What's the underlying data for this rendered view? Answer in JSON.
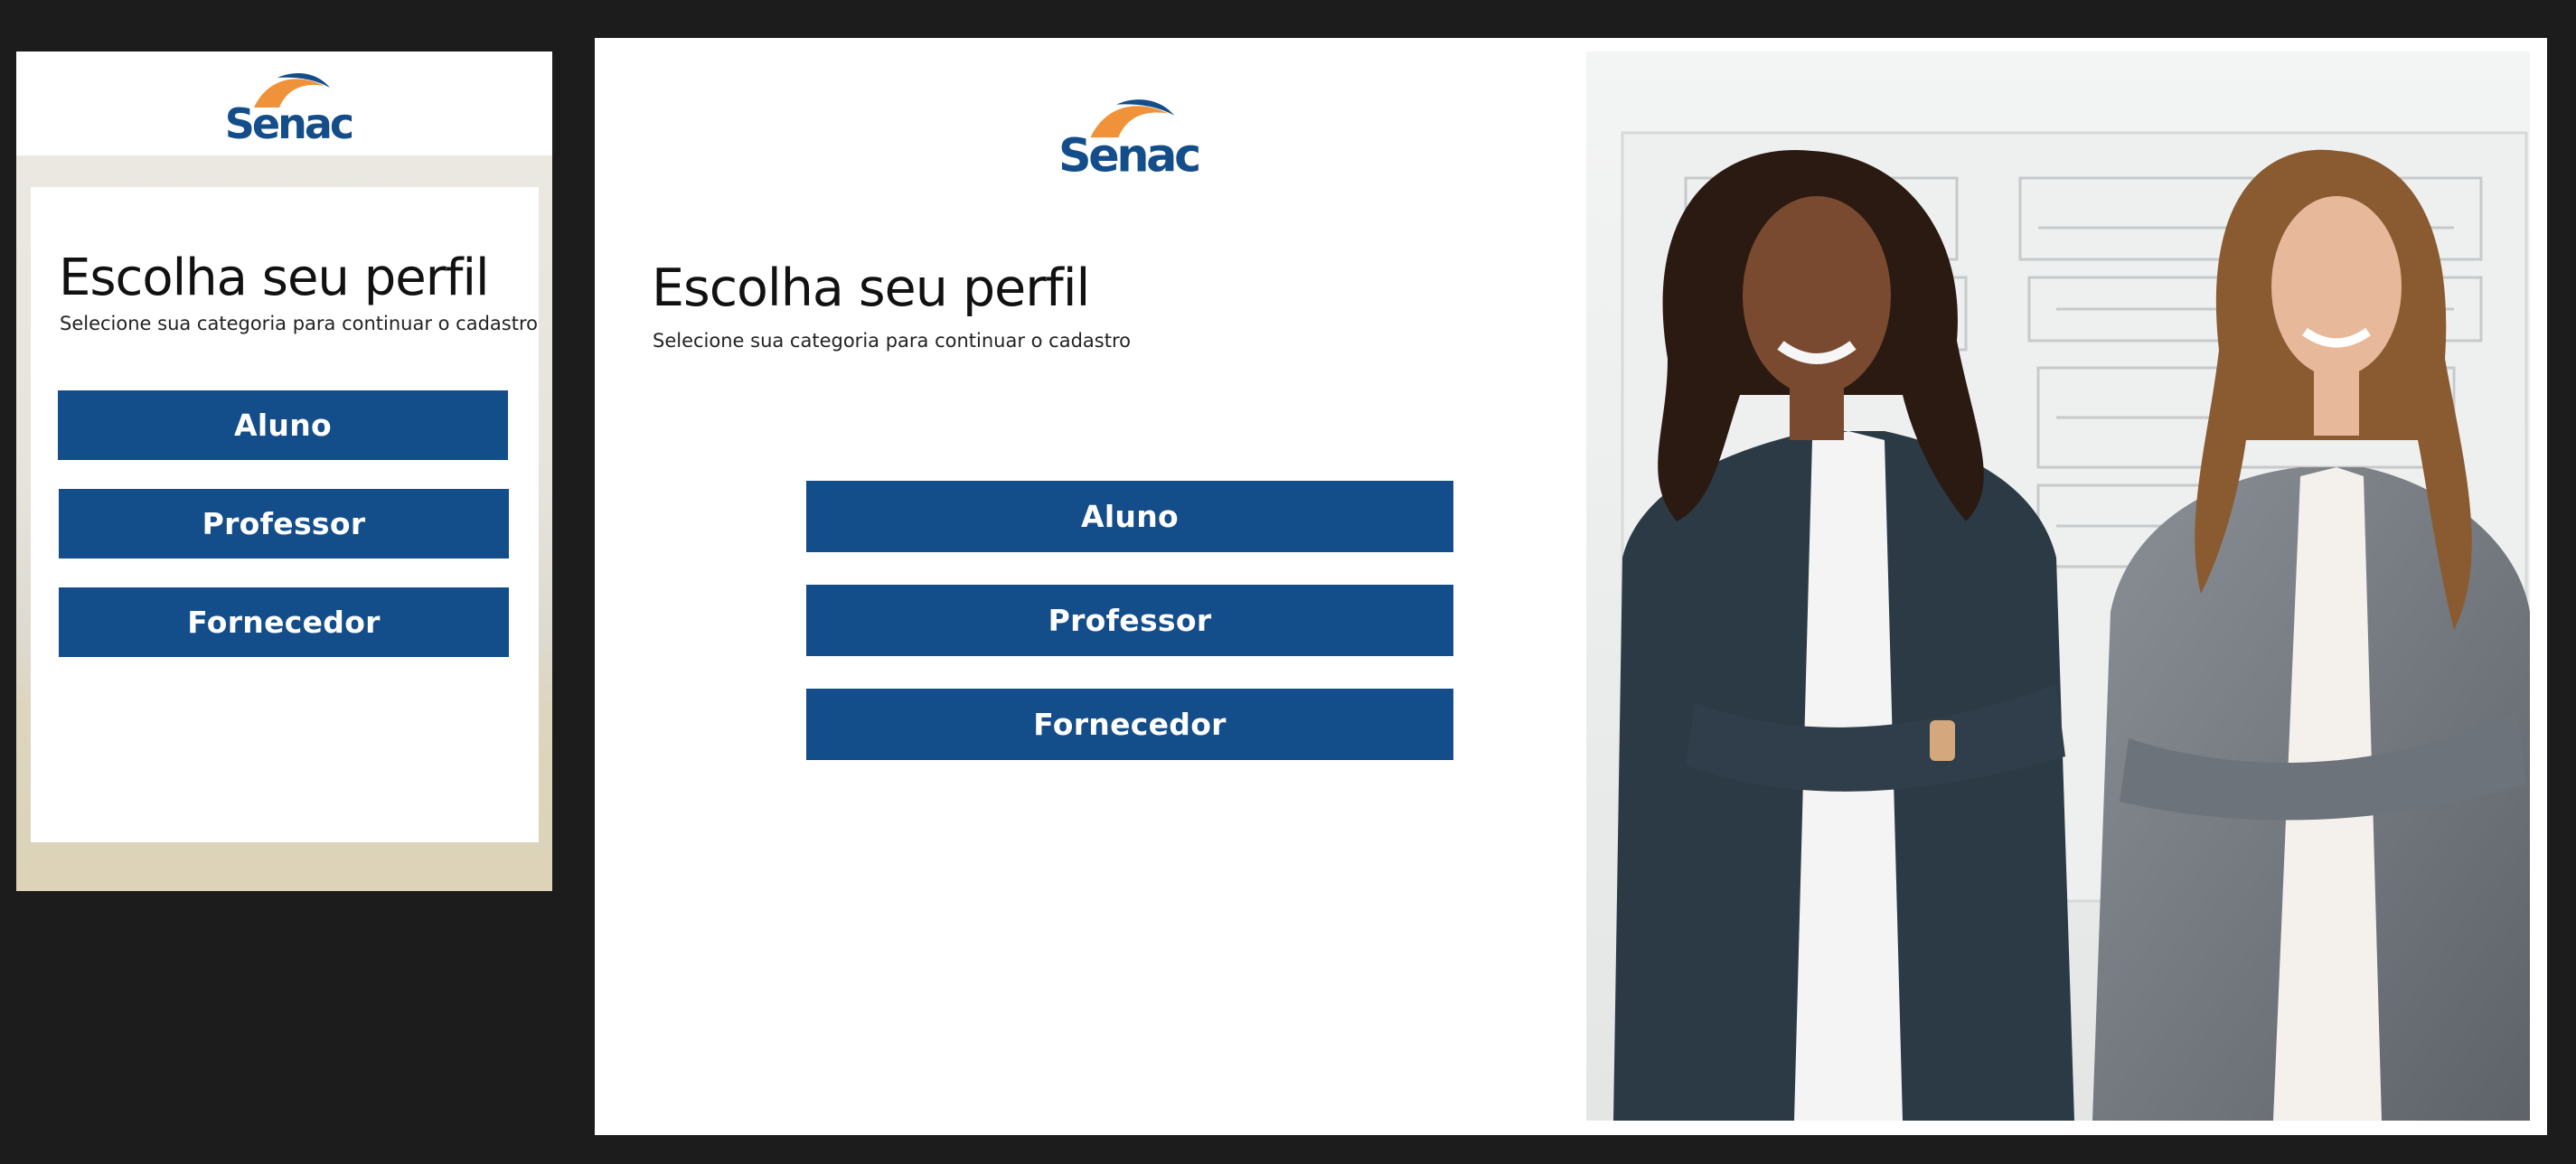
{
  "brand": {
    "name": "Senac",
    "color": "#134d8a",
    "accent_color": "#f0923a"
  },
  "profile_selection": {
    "title": "Escolha seu perfil",
    "subtitle": "Selecione sua categoria para continuar o cadastro",
    "options": [
      {
        "label": "Aluno"
      },
      {
        "label": "Professor"
      },
      {
        "label": "Fornecedor"
      }
    ]
  },
  "hero_image": {
    "subject": "two smiling women in blazers with arms crossed in front of a whiteboard"
  }
}
